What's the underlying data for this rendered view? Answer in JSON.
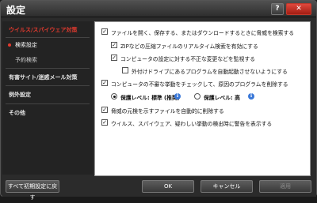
{
  "window": {
    "title": "設定",
    "help_label": "?",
    "close_label": "✕"
  },
  "sidebar": {
    "items": [
      {
        "label": "ウイルス/スパイウェア対策"
      },
      {
        "label": "検索設定"
      },
      {
        "label": "予約検索"
      },
      {
        "label": "有害サイト/迷惑メール対策"
      },
      {
        "label": "例外設定"
      },
      {
        "label": "その他"
      }
    ]
  },
  "content": {
    "options": [
      {
        "label": "ファイルを開く、保存する、またはダウンロードするときに脅威を検索する",
        "checked": true
      },
      {
        "label": "ZIPなどの圧縮ファイルのリアルタイム検索を有効にする",
        "checked": true
      },
      {
        "label": "コンピュータの設定に対する不正な変更などを監視する",
        "checked": true
      },
      {
        "label": "外付けドライブにあるプログラムを自動起動させないようにする",
        "checked": false
      },
      {
        "label": "コンピュータの不審な挙動をチェックして、原因のプログラムを削除する",
        "checked": true
      },
      {
        "label": "脅威の元検を示すファイルを自動的に削除する",
        "checked": true
      },
      {
        "label": "ウイルス、スパイウェア、疑わしい挙動の検出時に警告を表示する",
        "checked": true
      }
    ],
    "protection": {
      "standard_label": "保護レベル: 標準 (推奨)",
      "high_label": "保護レベル: 高",
      "selected": "standard",
      "info_label": "i"
    }
  },
  "footer": {
    "reset_label": "すべて初期設定に戻す",
    "ok_label": "OK",
    "cancel_label": "キャンセル",
    "apply_label": "適用"
  }
}
